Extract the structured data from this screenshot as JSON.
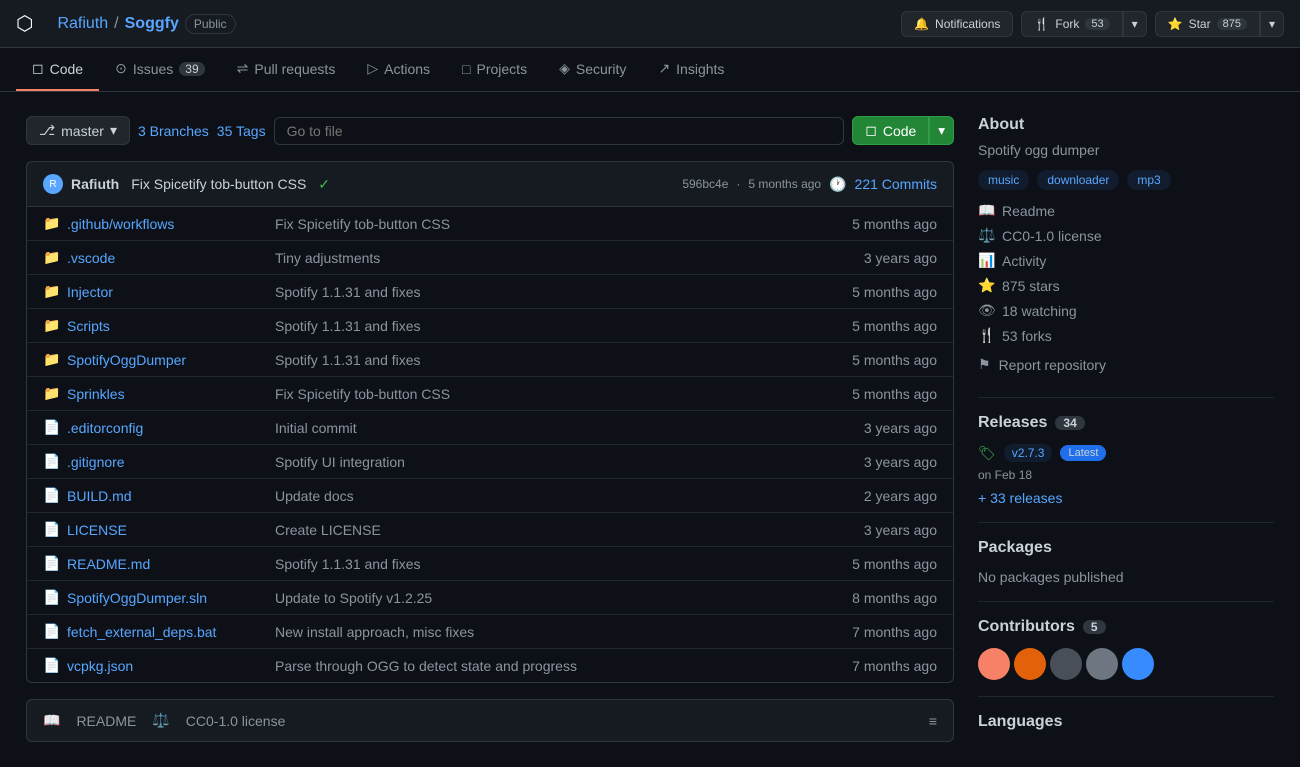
{
  "topNav": {
    "logo": "⬡",
    "repoOwner": "Rafiuth",
    "separator": "/",
    "repoName": "Soggfy",
    "publicBadge": "Public",
    "notifications": "Notifications",
    "forkLabel": "Fork",
    "forkCount": "53",
    "starLabel": "Star",
    "starCount": "875",
    "dropdownArrow": "▾"
  },
  "tabs": [
    {
      "icon": "◻",
      "label": "Code",
      "active": true,
      "count": null
    },
    {
      "icon": "⊙",
      "label": "Issues",
      "active": false,
      "count": "39"
    },
    {
      "icon": "⇌",
      "label": "Pull requests",
      "active": false,
      "count": null
    },
    {
      "icon": "▷",
      "label": "Actions",
      "active": false,
      "count": null
    },
    {
      "icon": "□",
      "label": "Projects",
      "active": false,
      "count": null
    },
    {
      "icon": "◈",
      "label": "Security",
      "active": false,
      "count": null
    },
    {
      "icon": "↗",
      "label": "Insights",
      "active": false,
      "count": null
    }
  ],
  "fileBar": {
    "branchName": "master",
    "branchCount": "3 Branches",
    "tagCount": "35 Tags",
    "goToFilePlaceholder": "Go to file",
    "codeLabel": "Code",
    "dropdownArrow": "▾"
  },
  "commitBar": {
    "authorName": "Rafiuth",
    "commitMessage": "Fix Spicetify tob-button CSS",
    "checkMark": "✓",
    "commitHash": "596bc4e",
    "commitTime": "5 months ago",
    "clockIcon": "🕐",
    "commitsCount": "221 Commits"
  },
  "files": [
    {
      "type": "folder",
      "name": ".github/workflows",
      "commit": "Fix Spicetify tob-button CSS",
      "time": "5 months ago"
    },
    {
      "type": "folder",
      "name": ".vscode",
      "commit": "Tiny adjustments",
      "time": "3 years ago"
    },
    {
      "type": "folder",
      "name": "Injector",
      "commit": "Spotify 1.1.31 and fixes",
      "time": "5 months ago"
    },
    {
      "type": "folder",
      "name": "Scripts",
      "commit": "Spotify 1.1.31 and fixes",
      "time": "5 months ago"
    },
    {
      "type": "folder",
      "name": "SpotifyOggDumper",
      "commit": "Spotify 1.1.31 and fixes",
      "time": "5 months ago"
    },
    {
      "type": "folder",
      "name": "Sprinkles",
      "commit": "Fix Spicetify tob-button CSS",
      "time": "5 months ago"
    },
    {
      "type": "file",
      "name": ".editorconfig",
      "commit": "Initial commit",
      "time": "3 years ago"
    },
    {
      "type": "file",
      "name": ".gitignore",
      "commit": "Spotify UI integration",
      "time": "3 years ago"
    },
    {
      "type": "file",
      "name": "BUILD.md",
      "commit": "Update docs",
      "time": "2 years ago"
    },
    {
      "type": "file",
      "name": "LICENSE",
      "commit": "Create LICENSE",
      "time": "3 years ago"
    },
    {
      "type": "file",
      "name": "README.md",
      "commit": "Spotify 1.1.31 and fixes",
      "time": "5 months ago"
    },
    {
      "type": "file",
      "name": "SpotifyOggDumper.sln",
      "commit": "Update to Spotify v1.2.25",
      "time": "8 months ago"
    },
    {
      "type": "file",
      "name": "fetch_external_deps.bat",
      "commit": "New install approach, misc fixes",
      "time": "7 months ago"
    },
    {
      "type": "file",
      "name": "vcpkg.json",
      "commit": "Parse through OGG to detect state and progress",
      "time": "7 months ago"
    }
  ],
  "about": {
    "title": "About",
    "description": "Spotify ogg dumper",
    "tags": [
      "music",
      "downloader",
      "mp3"
    ],
    "links": [
      {
        "icon": "📖",
        "label": "Readme"
      },
      {
        "icon": "⚖️",
        "label": "CC0-1.0 license"
      },
      {
        "icon": "📊",
        "label": "Activity"
      },
      {
        "icon": "⭐",
        "label": "875 stars"
      },
      {
        "icon": "👁",
        "label": "18 watching"
      },
      {
        "icon": "🍴",
        "label": "53 forks"
      }
    ],
    "reportRepo": "Report repository"
  },
  "releases": {
    "title": "Releases",
    "count": "34",
    "latest": {
      "tag": "v2.7.3",
      "badge": "Latest",
      "date": "on Feb 18"
    },
    "moreLink": "+ 33 releases"
  },
  "packages": {
    "title": "Packages",
    "emptyMessage": "No packages published"
  },
  "contributors": {
    "title": "Contributors",
    "count": "5"
  },
  "languages": {
    "title": "Languages"
  },
  "bottomBar": {
    "readmeLabel": "README",
    "licenseLabel": "CC0-1.0 license"
  }
}
